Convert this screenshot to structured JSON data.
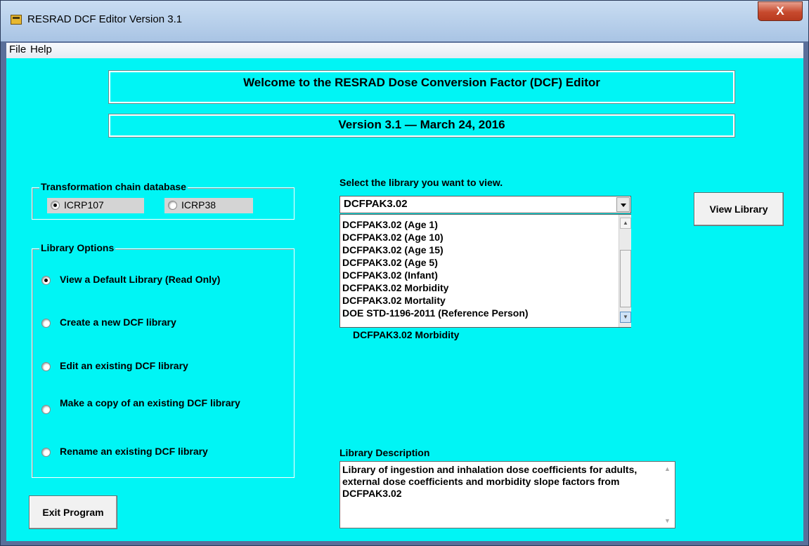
{
  "window": {
    "title": "RESRAD DCF Editor Version 3.1",
    "close_glyph": "X"
  },
  "menu": {
    "file": "File",
    "help": "Help"
  },
  "banners": {
    "welcome": "Welcome to the RESRAD Dose Conversion Factor (DCF) Editor",
    "version": "Version 3.1 — March 24, 2016"
  },
  "chain_db": {
    "legend": "Transformation chain database",
    "options": [
      {
        "label": "ICRP107",
        "selected": true
      },
      {
        "label": "ICRP38",
        "selected": false
      }
    ]
  },
  "library_options": {
    "legend": "Library Options",
    "options": [
      {
        "label": "View a Default Library (Read Only)",
        "selected": true
      },
      {
        "label": "Create a new DCF library",
        "selected": false
      },
      {
        "label": "Edit an existing DCF library",
        "selected": false
      },
      {
        "label": "Make a copy of an existing DCF library",
        "selected": false
      },
      {
        "label": "Rename an existing DCF library",
        "selected": false
      }
    ]
  },
  "library_select": {
    "prompt": "Select the library you want to view.",
    "selected_value": "DCFPAK3.02",
    "list_items": [
      "DCFPAK3.02 (Age 1)",
      "DCFPAK3.02 (Age 10)",
      "DCFPAK3.02 (Age 15)",
      "DCFPAK3.02 (Age 5)",
      "DCFPAK3.02 (Infant)",
      "DCFPAK3.02 Morbidity",
      "DCFPAK3.02 Mortality",
      "DOE STD-1196-2011 (Reference Person)"
    ],
    "underlying_label": "DCFPAK3.02 Morbidity"
  },
  "buttons": {
    "view_library": "View Library",
    "exit_program": "Exit Program"
  },
  "description": {
    "label": "Library Description",
    "text": "Library of ingestion and inhalation dose coefficients for adults, external dose coefficients and morbidity slope factors from DCFPAK3.02"
  },
  "colors": {
    "client_bg": "#00f5f5",
    "titlebar": "#b9d1ec",
    "close_button": "#c74a2e"
  }
}
